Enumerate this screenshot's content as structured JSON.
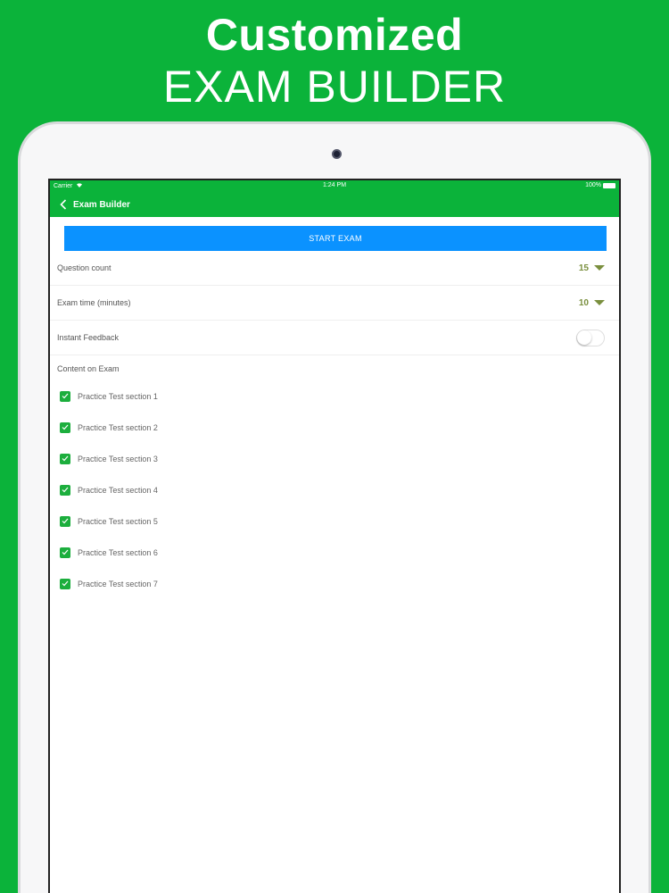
{
  "headline": {
    "line1": "Customized",
    "line2": "EXAM BUILDER"
  },
  "statusbar": {
    "carrier": "Carrier",
    "time": "1:24 PM",
    "battery": "100%"
  },
  "navbar": {
    "title": "Exam Builder"
  },
  "start_button": {
    "label": "START EXAM"
  },
  "settings": {
    "question_count": {
      "label": "Question count",
      "value": "15"
    },
    "exam_time": {
      "label": "Exam time (minutes)",
      "value": "10"
    },
    "instant_feedback": {
      "label": "Instant Feedback",
      "enabled": false
    }
  },
  "content": {
    "label": "Content on Exam",
    "sections": [
      {
        "label": "Practice Test section 1",
        "checked": true
      },
      {
        "label": "Practice Test section 2",
        "checked": true
      },
      {
        "label": "Practice Test section 3",
        "checked": true
      },
      {
        "label": "Practice Test section 4",
        "checked": true
      },
      {
        "label": "Practice Test section 5",
        "checked": true
      },
      {
        "label": "Practice Test section 6",
        "checked": true
      },
      {
        "label": "Practice Test section 7",
        "checked": true
      }
    ]
  },
  "colors": {
    "brand_green": "#0bb33a",
    "start_button_blue": "#0b92ff",
    "value_olive": "#7a8f3e",
    "checkbox_green": "#1cae3d"
  }
}
